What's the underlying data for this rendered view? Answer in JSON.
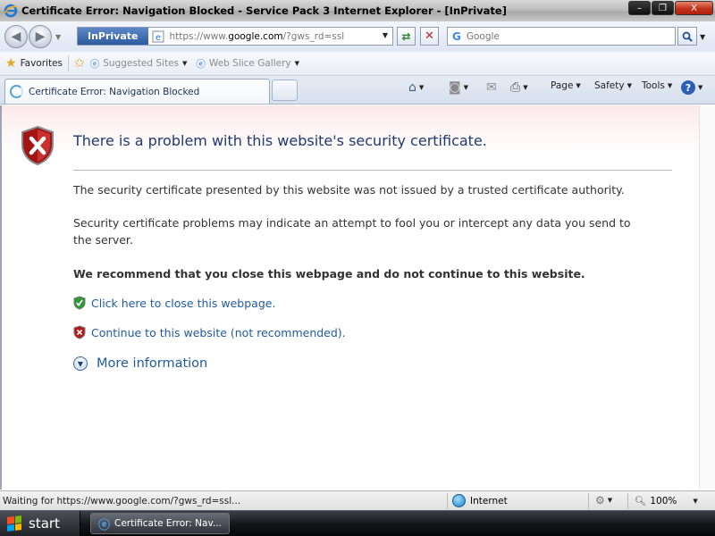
{
  "window": {
    "title": "Certificate Error: Navigation Blocked - Service Pack 3 Internet Explorer - [InPrivate]",
    "minimize": "–",
    "maximize": "❐",
    "close": "X"
  },
  "address_bar": {
    "inprivate_label": "InPrivate",
    "url_prefix": "https://www.",
    "url_host": "google.com",
    "url_suffix": "/?gws_rd=ssl",
    "search_placeholder": "Google",
    "search_engine_glyph": "G"
  },
  "favorites_bar": {
    "favorites_label": "Favorites",
    "suggested_sites_label": "Suggested Sites",
    "web_slice_label": "Web Slice Gallery"
  },
  "tab": {
    "label": "Certificate Error: Navigation Blocked"
  },
  "command_bar": {
    "page_label": "Page",
    "safety_label": "Safety",
    "tools_label": "Tools",
    "help_glyph": "?"
  },
  "content": {
    "heading": "There is a problem with this website's security certificate.",
    "paragraph1": "The security certificate presented by this website was not issued by a trusted certificate authority.",
    "paragraph2": "Security certificate problems may indicate an attempt to fool you or intercept any data you send to the server.",
    "recommendation": "We recommend that you close this webpage and do not continue to this website.",
    "close_link": "Click here to close this webpage.",
    "continue_link": "Continue to this website (not recommended).",
    "more_info": "More information"
  },
  "status_bar": {
    "status_text": "Waiting for https://www.google.com/?gws_rd=ssl...",
    "zone": "Internet",
    "zoom": "100%"
  },
  "taskbar": {
    "start_label": "start",
    "task_label": "Certificate Error: Nav..."
  },
  "colors": {
    "heading": "#1f3a73",
    "link": "#1f5a9e",
    "inprivate_bg": "#2e5aa0",
    "close_button": "#c0321a"
  }
}
